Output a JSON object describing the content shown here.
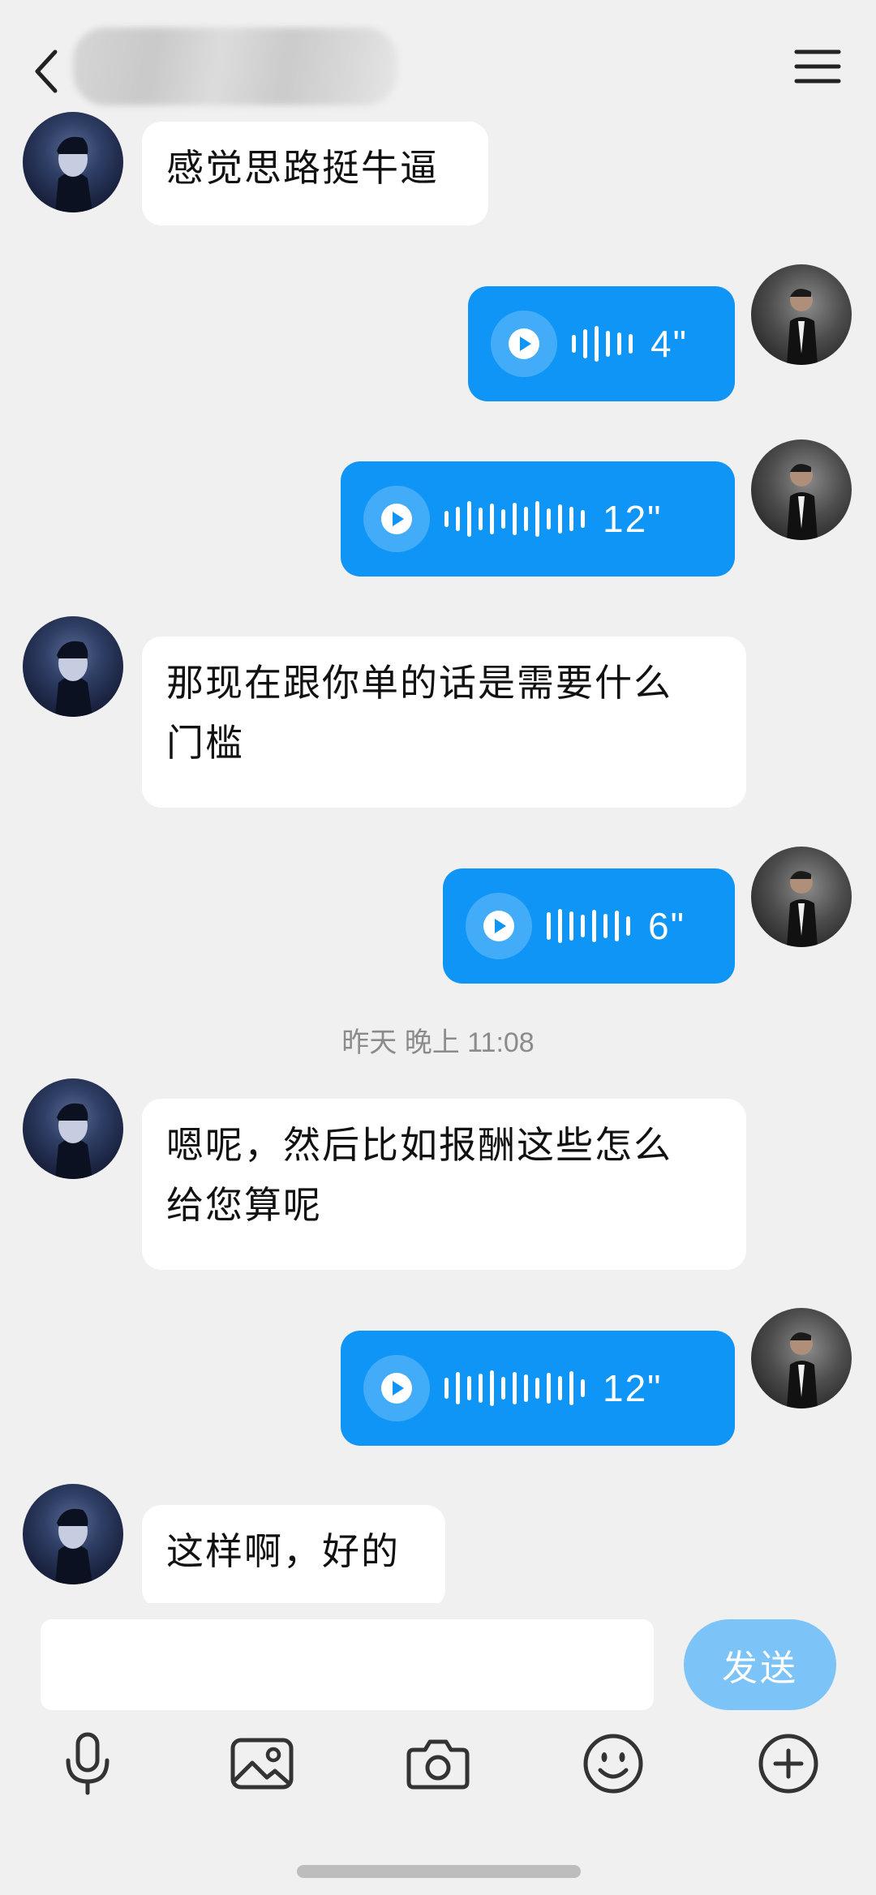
{
  "header": {
    "contact_name": "▓▓▓▓▓▓▓",
    "back_icon": "chevron-left-icon",
    "menu_icon": "hamburger-menu-icon"
  },
  "messages": [
    {
      "sender": "other",
      "type": "text",
      "text": "感觉思路挺牛逼"
    },
    {
      "sender": "me",
      "type": "voice",
      "duration": "4\""
    },
    {
      "sender": "me",
      "type": "voice",
      "duration": "12\""
    },
    {
      "sender": "other",
      "type": "text",
      "line1": "那现在跟你单的话是需要什么",
      "line2": "门槛"
    },
    {
      "sender": "me",
      "type": "voice",
      "duration": "6\""
    },
    {
      "sender": "other",
      "type": "text",
      "line1": "嗯呢，然后比如报酬这些怎么",
      "line2": "给您算呢"
    },
    {
      "sender": "me",
      "type": "voice",
      "duration": "12\""
    },
    {
      "sender": "other",
      "type": "text",
      "text": "这样啊，好的"
    }
  ],
  "timestamp": "昨天 晚上 11:08",
  "composer": {
    "input_value": "",
    "send_label": "发送"
  },
  "toolbar": {
    "icons": [
      "microphone-icon",
      "image-icon",
      "camera-icon",
      "emoji-icon",
      "plus-circle-icon"
    ]
  },
  "colors": {
    "voice_bubble": "#0f95f6",
    "send_button": "#7cc3f8",
    "background": "#f0f0f0"
  }
}
